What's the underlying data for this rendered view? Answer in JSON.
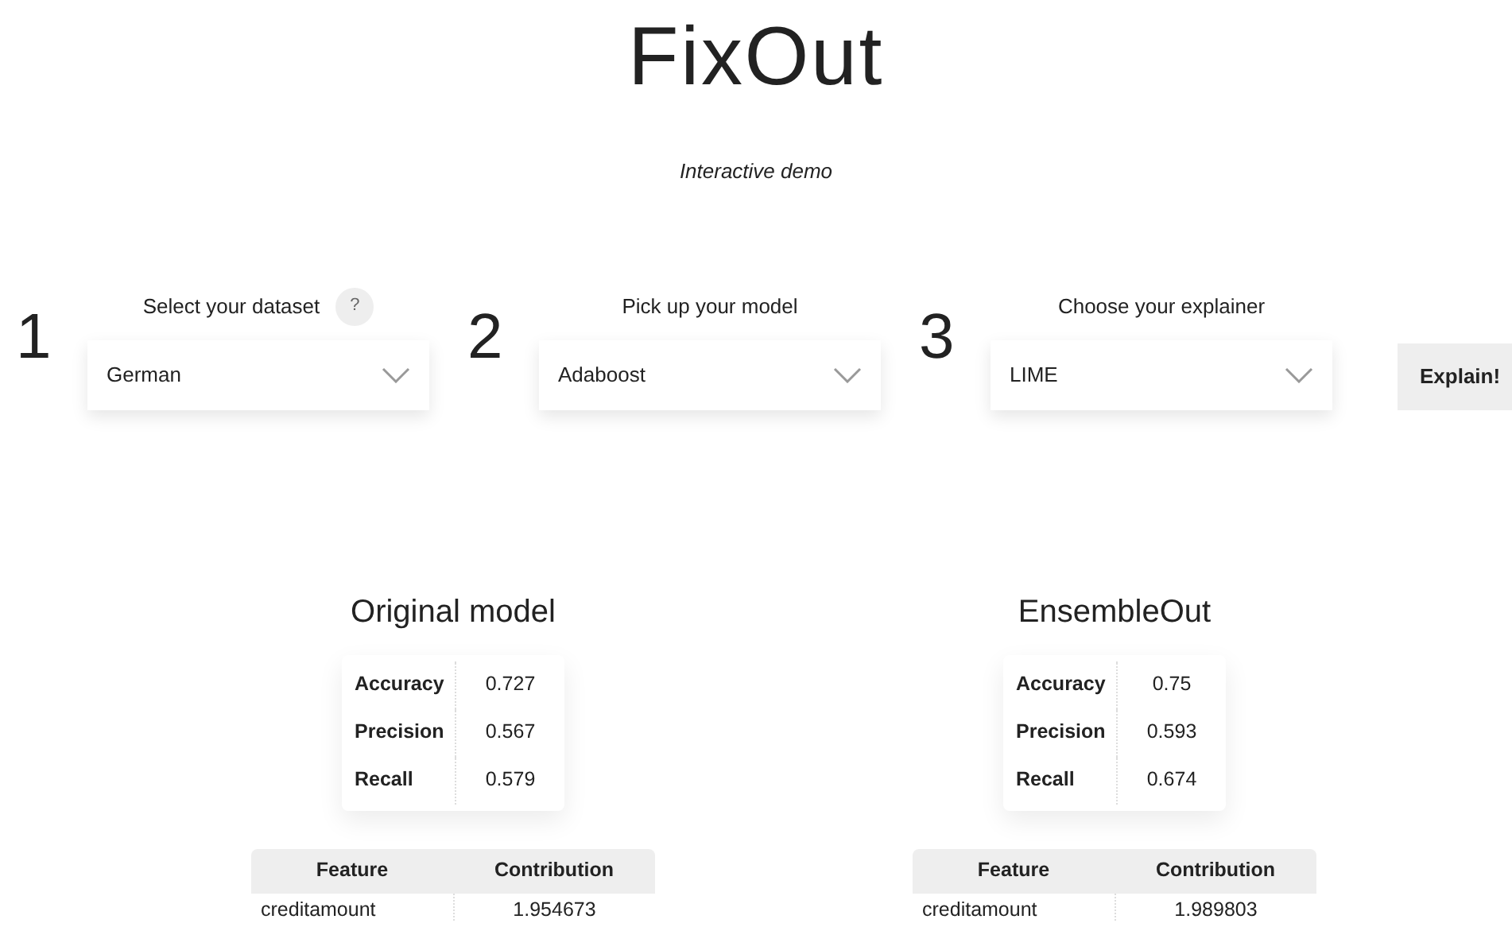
{
  "title": "FixOut",
  "subtitle": "Interactive demo",
  "steps": [
    {
      "number": "1",
      "label": "Select your dataset",
      "help": "?",
      "value": "German"
    },
    {
      "number": "2",
      "label": "Pick up your model",
      "value": "Adaboost"
    },
    {
      "number": "3",
      "label": "Choose your explainer",
      "value": "LIME"
    }
  ],
  "explain_button": "Explain!",
  "results": [
    {
      "title": "Original model",
      "metrics": [
        {
          "name": "Accuracy",
          "value": "0.727"
        },
        {
          "name": "Precision",
          "value": "0.567"
        },
        {
          "name": "Recall",
          "value": "0.579"
        }
      ],
      "table": {
        "columns": [
          "Feature",
          "Contribution"
        ],
        "rows": [
          [
            "creditamount",
            "1.954673"
          ]
        ]
      }
    },
    {
      "title": "EnsembleOut",
      "metrics": [
        {
          "name": "Accuracy",
          "value": "0.75"
        },
        {
          "name": "Precision",
          "value": "0.593"
        },
        {
          "name": "Recall",
          "value": "0.674"
        }
      ],
      "table": {
        "columns": [
          "Feature",
          "Contribution"
        ],
        "rows": [
          [
            "creditamount",
            "1.989803"
          ]
        ]
      }
    }
  ]
}
